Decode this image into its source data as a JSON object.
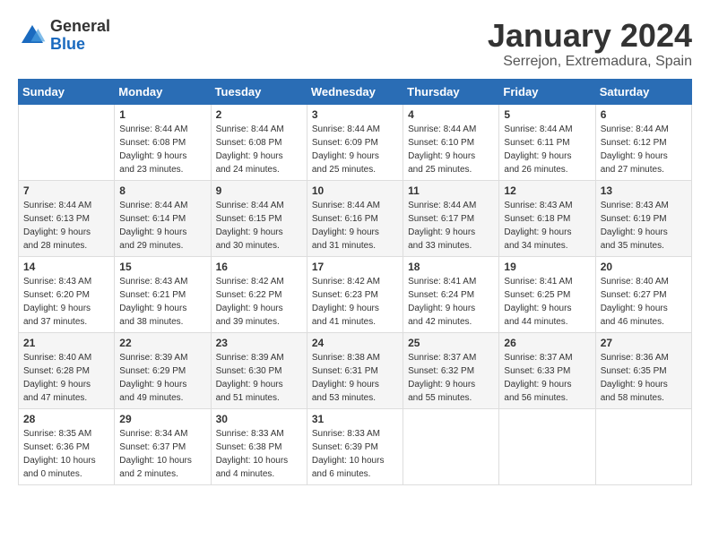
{
  "logo": {
    "general": "General",
    "blue": "Blue"
  },
  "calendar": {
    "title": "January 2024",
    "subtitle": "Serrejon, Extremadura, Spain"
  },
  "weekdays": [
    "Sunday",
    "Monday",
    "Tuesday",
    "Wednesday",
    "Thursday",
    "Friday",
    "Saturday"
  ],
  "weeks": [
    [
      {
        "day": "",
        "info": ""
      },
      {
        "day": "1",
        "info": "Sunrise: 8:44 AM\nSunset: 6:08 PM\nDaylight: 9 hours\nand 23 minutes."
      },
      {
        "day": "2",
        "info": "Sunrise: 8:44 AM\nSunset: 6:08 PM\nDaylight: 9 hours\nand 24 minutes."
      },
      {
        "day": "3",
        "info": "Sunrise: 8:44 AM\nSunset: 6:09 PM\nDaylight: 9 hours\nand 25 minutes."
      },
      {
        "day": "4",
        "info": "Sunrise: 8:44 AM\nSunset: 6:10 PM\nDaylight: 9 hours\nand 25 minutes."
      },
      {
        "day": "5",
        "info": "Sunrise: 8:44 AM\nSunset: 6:11 PM\nDaylight: 9 hours\nand 26 minutes."
      },
      {
        "day": "6",
        "info": "Sunrise: 8:44 AM\nSunset: 6:12 PM\nDaylight: 9 hours\nand 27 minutes."
      }
    ],
    [
      {
        "day": "7",
        "info": "Sunrise: 8:44 AM\nSunset: 6:13 PM\nDaylight: 9 hours\nand 28 minutes."
      },
      {
        "day": "8",
        "info": "Sunrise: 8:44 AM\nSunset: 6:14 PM\nDaylight: 9 hours\nand 29 minutes."
      },
      {
        "day": "9",
        "info": "Sunrise: 8:44 AM\nSunset: 6:15 PM\nDaylight: 9 hours\nand 30 minutes."
      },
      {
        "day": "10",
        "info": "Sunrise: 8:44 AM\nSunset: 6:16 PM\nDaylight: 9 hours\nand 31 minutes."
      },
      {
        "day": "11",
        "info": "Sunrise: 8:44 AM\nSunset: 6:17 PM\nDaylight: 9 hours\nand 33 minutes."
      },
      {
        "day": "12",
        "info": "Sunrise: 8:43 AM\nSunset: 6:18 PM\nDaylight: 9 hours\nand 34 minutes."
      },
      {
        "day": "13",
        "info": "Sunrise: 8:43 AM\nSunset: 6:19 PM\nDaylight: 9 hours\nand 35 minutes."
      }
    ],
    [
      {
        "day": "14",
        "info": "Sunrise: 8:43 AM\nSunset: 6:20 PM\nDaylight: 9 hours\nand 37 minutes."
      },
      {
        "day": "15",
        "info": "Sunrise: 8:43 AM\nSunset: 6:21 PM\nDaylight: 9 hours\nand 38 minutes."
      },
      {
        "day": "16",
        "info": "Sunrise: 8:42 AM\nSunset: 6:22 PM\nDaylight: 9 hours\nand 39 minutes."
      },
      {
        "day": "17",
        "info": "Sunrise: 8:42 AM\nSunset: 6:23 PM\nDaylight: 9 hours\nand 41 minutes."
      },
      {
        "day": "18",
        "info": "Sunrise: 8:41 AM\nSunset: 6:24 PM\nDaylight: 9 hours\nand 42 minutes."
      },
      {
        "day": "19",
        "info": "Sunrise: 8:41 AM\nSunset: 6:25 PM\nDaylight: 9 hours\nand 44 minutes."
      },
      {
        "day": "20",
        "info": "Sunrise: 8:40 AM\nSunset: 6:27 PM\nDaylight: 9 hours\nand 46 minutes."
      }
    ],
    [
      {
        "day": "21",
        "info": "Sunrise: 8:40 AM\nSunset: 6:28 PM\nDaylight: 9 hours\nand 47 minutes."
      },
      {
        "day": "22",
        "info": "Sunrise: 8:39 AM\nSunset: 6:29 PM\nDaylight: 9 hours\nand 49 minutes."
      },
      {
        "day": "23",
        "info": "Sunrise: 8:39 AM\nSunset: 6:30 PM\nDaylight: 9 hours\nand 51 minutes."
      },
      {
        "day": "24",
        "info": "Sunrise: 8:38 AM\nSunset: 6:31 PM\nDaylight: 9 hours\nand 53 minutes."
      },
      {
        "day": "25",
        "info": "Sunrise: 8:37 AM\nSunset: 6:32 PM\nDaylight: 9 hours\nand 55 minutes."
      },
      {
        "day": "26",
        "info": "Sunrise: 8:37 AM\nSunset: 6:33 PM\nDaylight: 9 hours\nand 56 minutes."
      },
      {
        "day": "27",
        "info": "Sunrise: 8:36 AM\nSunset: 6:35 PM\nDaylight: 9 hours\nand 58 minutes."
      }
    ],
    [
      {
        "day": "28",
        "info": "Sunrise: 8:35 AM\nSunset: 6:36 PM\nDaylight: 10 hours\nand 0 minutes."
      },
      {
        "day": "29",
        "info": "Sunrise: 8:34 AM\nSunset: 6:37 PM\nDaylight: 10 hours\nand 2 minutes."
      },
      {
        "day": "30",
        "info": "Sunrise: 8:33 AM\nSunset: 6:38 PM\nDaylight: 10 hours\nand 4 minutes."
      },
      {
        "day": "31",
        "info": "Sunrise: 8:33 AM\nSunset: 6:39 PM\nDaylight: 10 hours\nand 6 minutes."
      },
      {
        "day": "",
        "info": ""
      },
      {
        "day": "",
        "info": ""
      },
      {
        "day": "",
        "info": ""
      }
    ]
  ]
}
